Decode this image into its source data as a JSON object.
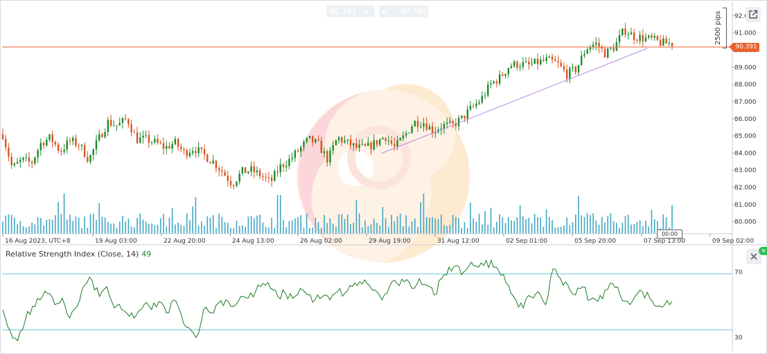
{
  "quote": {
    "bid": "90.391",
    "ask": "90.393",
    "arrow_left": "◂",
    "arrow_right": "▸"
  },
  "price_scale_label": "2500 pips",
  "current_price": "90.391",
  "crosshair_time": "00:00",
  "green_tab": "N",
  "chart_data": [
    {
      "type": "candlestick",
      "price_axis": {
        "ticks": [
          "92.000",
          "91.000",
          "90.000",
          "89.000",
          "88.000",
          "87.000",
          "86.000",
          "85.000",
          "84.000",
          "83.000",
          "82.000",
          "81.000",
          "80.000"
        ],
        "range": [
          79.3,
          92.6
        ]
      },
      "time_axis": {
        "ticks": [
          "16 Aug 2023, UTC+8",
          "19 Aug 03:00",
          "22 Aug 20:00",
          "24 Aug 13:00",
          "26 Aug 02:00",
          "29 Aug 19:00",
          "31 Aug 12:00",
          "02 Sep 01:00",
          "05 Sep 20:00",
          "07 Sep 13:00",
          "09 Sep 02:00"
        ]
      },
      "current_price": 90.391,
      "close_path": [
        [
          0,
          85.1
        ],
        [
          6,
          83.1
        ],
        [
          12,
          83.6
        ],
        [
          18,
          83.4
        ],
        [
          24,
          84.6
        ],
        [
          30,
          84.9
        ],
        [
          36,
          84.1
        ],
        [
          42,
          84.7
        ],
        [
          48,
          84.5
        ],
        [
          54,
          83.6
        ],
        [
          60,
          84.8
        ],
        [
          66,
          85.8
        ],
        [
          72,
          85.6
        ],
        [
          78,
          86.0
        ],
        [
          84,
          84.8
        ],
        [
          90,
          84.8
        ],
        [
          96,
          84.6
        ],
        [
          102,
          84.3
        ],
        [
          108,
          84.6
        ],
        [
          114,
          84.0
        ],
        [
          120,
          84.3
        ],
        [
          126,
          83.9
        ],
        [
          132,
          83.5
        ],
        [
          138,
          82.9
        ],
        [
          144,
          82.2
        ],
        [
          150,
          82.9
        ],
        [
          156,
          83.0
        ],
        [
          162,
          82.7
        ],
        [
          168,
          82.3
        ],
        [
          174,
          83.2
        ],
        [
          180,
          83.6
        ],
        [
          186,
          84.2
        ],
        [
          192,
          84.8
        ],
        [
          198,
          84.5
        ],
        [
          204,
          83.6
        ],
        [
          210,
          84.9
        ],
        [
          216,
          84.6
        ],
        [
          222,
          84.3
        ],
        [
          228,
          84.3
        ],
        [
          234,
          84.6
        ],
        [
          240,
          85.0
        ],
        [
          246,
          84.3
        ],
        [
          252,
          85.0
        ],
        [
          258,
          85.8
        ],
        [
          264,
          85.8
        ],
        [
          270,
          85.3
        ],
        [
          276,
          85.6
        ],
        [
          282,
          85.6
        ],
        [
          288,
          86.0
        ],
        [
          294,
          86.6
        ],
        [
          300,
          87.1
        ],
        [
          306,
          88.0
        ],
        [
          312,
          88.4
        ],
        [
          318,
          89.1
        ],
        [
          324,
          89.2
        ],
        [
          330,
          89.1
        ],
        [
          336,
          89.3
        ],
        [
          342,
          89.4
        ],
        [
          348,
          89.2
        ],
        [
          354,
          88.6
        ],
        [
          360,
          88.9
        ],
        [
          366,
          90.1
        ],
        [
          372,
          90.4
        ],
        [
          378,
          89.8
        ],
        [
          384,
          90.2
        ],
        [
          390,
          91.2
        ],
        [
          396,
          90.8
        ],
        [
          402,
          90.7
        ],
        [
          408,
          90.6
        ],
        [
          414,
          90.4
        ],
        [
          420,
          90.4
        ]
      ],
      "volume_style": "blue histogram bars along bottom of price panel",
      "trendline": {
        "color": "#b48be0",
        "from": [
          211,
          83.9
        ],
        "to": [
          405,
          90.3
        ]
      },
      "horizontal_line": {
        "price": 90.391,
        "color": "#e8612c"
      }
    },
    {
      "type": "line",
      "title": "Relative Strength Index (Close, 14)",
      "last_value": "49",
      "y_ticks": [
        "70",
        "30"
      ],
      "levels": [
        70,
        30
      ],
      "y_range": [
        25,
        82
      ],
      "points": [
        [
          0,
          47
        ],
        [
          3,
          34
        ],
        [
          6,
          28
        ],
        [
          9,
          40
        ],
        [
          12,
          49
        ],
        [
          15,
          53
        ],
        [
          18,
          57
        ],
        [
          21,
          50
        ],
        [
          24,
          54
        ],
        [
          27,
          42
        ],
        [
          30,
          49
        ],
        [
          33,
          62
        ],
        [
          36,
          65
        ],
        [
          39,
          55
        ],
        [
          42,
          61
        ],
        [
          45,
          48
        ],
        [
          48,
          47
        ],
        [
          51,
          43
        ],
        [
          54,
          44
        ],
        [
          57,
          50
        ],
        [
          60,
          47
        ],
        [
          63,
          52
        ],
        [
          66,
          45
        ],
        [
          69,
          53
        ],
        [
          72,
          44
        ],
        [
          75,
          36
        ],
        [
          78,
          30
        ],
        [
          81,
          47
        ],
        [
          84,
          45
        ],
        [
          87,
          51
        ],
        [
          90,
          53
        ],
        [
          93,
          49
        ],
        [
          96,
          55
        ],
        [
          99,
          54
        ],
        [
          102,
          58
        ],
        [
          105,
          63
        ],
        [
          108,
          60
        ],
        [
          111,
          55
        ],
        [
          114,
          57
        ],
        [
          117,
          54
        ],
        [
          120,
          60
        ],
        [
          123,
          56
        ],
        [
          126,
          53
        ],
        [
          129,
          55
        ],
        [
          132,
          53
        ],
        [
          135,
          58
        ],
        [
          138,
          57
        ],
        [
          141,
          61
        ],
        [
          144,
          64
        ],
        [
          147,
          63
        ],
        [
          150,
          59
        ],
        [
          153,
          53
        ],
        [
          156,
          61
        ],
        [
          159,
          63
        ],
        [
          162,
          64
        ],
        [
          165,
          60
        ],
        [
          168,
          66
        ],
        [
          171,
          62
        ],
        [
          174,
          56
        ],
        [
          177,
          66
        ],
        [
          180,
          73
        ],
        [
          183,
          74
        ],
        [
          186,
          70
        ],
        [
          189,
          76
        ],
        [
          192,
          73
        ],
        [
          195,
          77
        ],
        [
          198,
          73
        ],
        [
          201,
          68
        ],
        [
          204,
          62
        ],
        [
          207,
          53
        ],
        [
          210,
          48
        ],
        [
          213,
          55
        ],
        [
          216,
          58
        ],
        [
          219,
          50
        ],
        [
          222,
          72
        ],
        [
          225,
          66
        ],
        [
          228,
          62
        ],
        [
          231,
          56
        ],
        [
          234,
          61
        ],
        [
          237,
          53
        ],
        [
          240,
          52
        ],
        [
          243,
          59
        ],
        [
          246,
          63
        ],
        [
          249,
          56
        ],
        [
          252,
          52
        ],
        [
          255,
          55
        ],
        [
          258,
          58
        ],
        [
          261,
          54
        ],
        [
          264,
          49
        ],
        [
          267,
          50
        ],
        [
          270,
          52
        ]
      ]
    }
  ]
}
